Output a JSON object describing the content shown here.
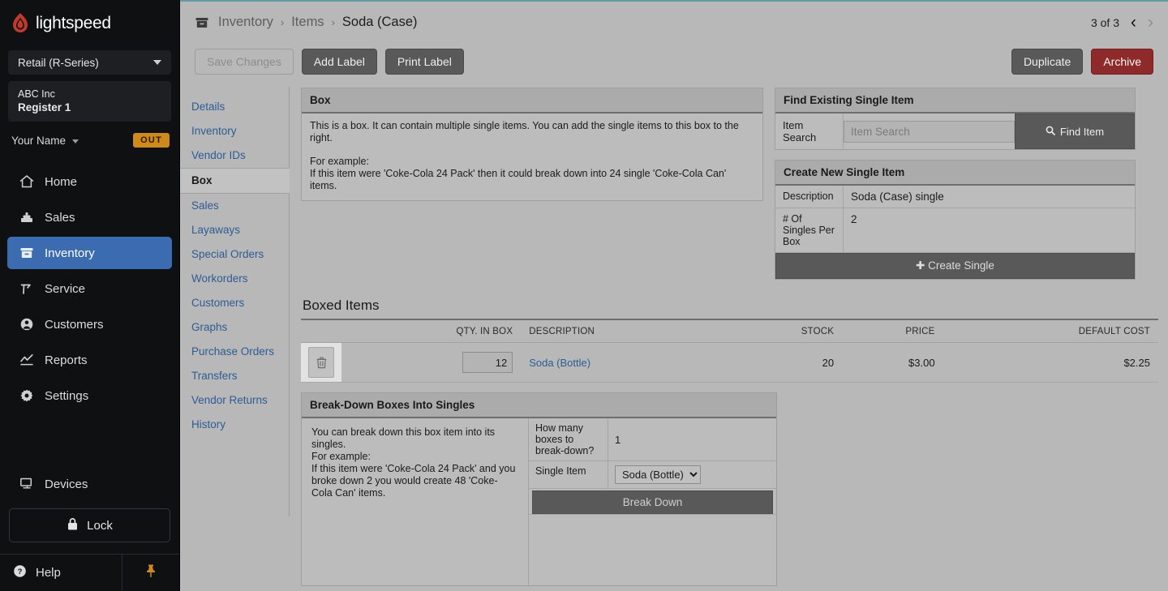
{
  "sidebar": {
    "brand": "lightspeed",
    "brand_icon": "flame-logo-icon",
    "series_selector": "Retail (R-Series)",
    "store": {
      "company": "ABC Inc",
      "register": "Register 1"
    },
    "user": {
      "name": "Your Name",
      "status_badge": "OUT"
    },
    "nav": [
      {
        "label": "Home",
        "icon": "home-icon",
        "active": false
      },
      {
        "label": "Sales",
        "icon": "cash-register-icon",
        "active": false
      },
      {
        "label": "Inventory",
        "icon": "inventory-box-icon",
        "active": true
      },
      {
        "label": "Service",
        "icon": "wrench-icon",
        "active": false
      },
      {
        "label": "Customers",
        "icon": "person-circle-icon",
        "active": false
      },
      {
        "label": "Reports",
        "icon": "chart-line-icon",
        "active": false
      },
      {
        "label": "Settings",
        "icon": "gear-icon",
        "active": false
      }
    ],
    "devices": {
      "label": "Devices",
      "icon": "monitor-icon"
    },
    "lock": {
      "label": "Lock",
      "icon": "lock-icon"
    },
    "help": {
      "label": "Help",
      "icon": "question-circle-icon"
    },
    "pin": {
      "icon": "pin-icon"
    }
  },
  "header": {
    "breadcrumb_icon": "inventory-box-icon",
    "breadcrumb": [
      "Inventory",
      "Items",
      "Soda (Case)"
    ],
    "separator": "›",
    "page_count": "3 of 3",
    "prev_icon": "chevron-left-icon",
    "next_icon": "chevron-right-icon"
  },
  "toolbar": {
    "save_changes": "Save Changes",
    "add_label": "Add Label",
    "print_label": "Print Label",
    "duplicate": "Duplicate",
    "archive": "Archive"
  },
  "subnav": {
    "items": [
      {
        "label": "Details",
        "active": false
      },
      {
        "label": "Inventory",
        "active": false
      },
      {
        "label": "Vendor IDs",
        "active": false
      },
      {
        "label": "Box",
        "active": true
      },
      {
        "label": "Sales",
        "active": false
      },
      {
        "label": "Layaways",
        "active": false
      },
      {
        "label": "Special Orders",
        "active": false
      },
      {
        "label": "Workorders",
        "active": false
      },
      {
        "label": "Customers",
        "active": false
      },
      {
        "label": "Graphs",
        "active": false
      },
      {
        "label": "Purchase Orders",
        "active": false
      },
      {
        "label": "Transfers",
        "active": false
      },
      {
        "label": "Vendor Returns",
        "active": false
      },
      {
        "label": "History",
        "active": false
      }
    ]
  },
  "box_panel": {
    "title": "Box",
    "para1": "This is a box. It can contain multiple single items. You can add the single items to this box to the right.",
    "para2_head": "For example:",
    "para2": "If this item were 'Coke-Cola 24 Pack' then it could break down into 24 single 'Coke-Cola Can' items."
  },
  "find_existing": {
    "title": "Find Existing Single Item",
    "search_label": "Item Search",
    "search_value": "",
    "search_placeholder": "Item Search",
    "find_button": "Find Item",
    "find_icon": "search-icon"
  },
  "create_single": {
    "title": "Create New Single Item",
    "description_label": "Description",
    "description_value": "Soda (Case) single",
    "singles_label": "# Of Singles Per Box",
    "singles_value": "2",
    "button": "Create Single",
    "button_icon": "plus-icon"
  },
  "boxed_items": {
    "title": "Boxed Items",
    "columns": [
      "",
      "QTY. IN BOX",
      "DESCRIPTION",
      "STOCK",
      "PRICE",
      "DEFAULT COST"
    ],
    "rows": [
      {
        "delete_icon": "trash-icon",
        "qty_in_box": "12",
        "description": "Soda (Bottle)",
        "stock": "20",
        "price": "$3.00",
        "default_cost": "$2.25"
      }
    ]
  },
  "breakdown": {
    "title": "Break-Down Boxes Into Singles",
    "para1": "You can break down this box item into its singles.",
    "para2_head": "For example:",
    "para2": "If this item were 'Coke-Cola 24 Pack' and you broke down 2 you would create 48 'Coke-Cola Can' items.",
    "how_many_label": "How many boxes to break-down?",
    "how_many_value": "1",
    "single_item_label": "Single Item",
    "single_item_value": "Soda (Bottle)",
    "single_item_options": [
      "Soda (Bottle)"
    ],
    "button": "Break Down",
    "chevron_icon": "chevron-down-icon"
  },
  "colors": {
    "accent_blue": "#3b6bb0",
    "link_blue": "#2d5c94",
    "brand_red": "#c0392b",
    "archive_red": "#8e2a2a",
    "badge_orange": "#d08a1c",
    "teal_rule": "#5f9ea0",
    "page_bg": "#b8b8b8",
    "sidebar_bg": "#0f1012"
  }
}
